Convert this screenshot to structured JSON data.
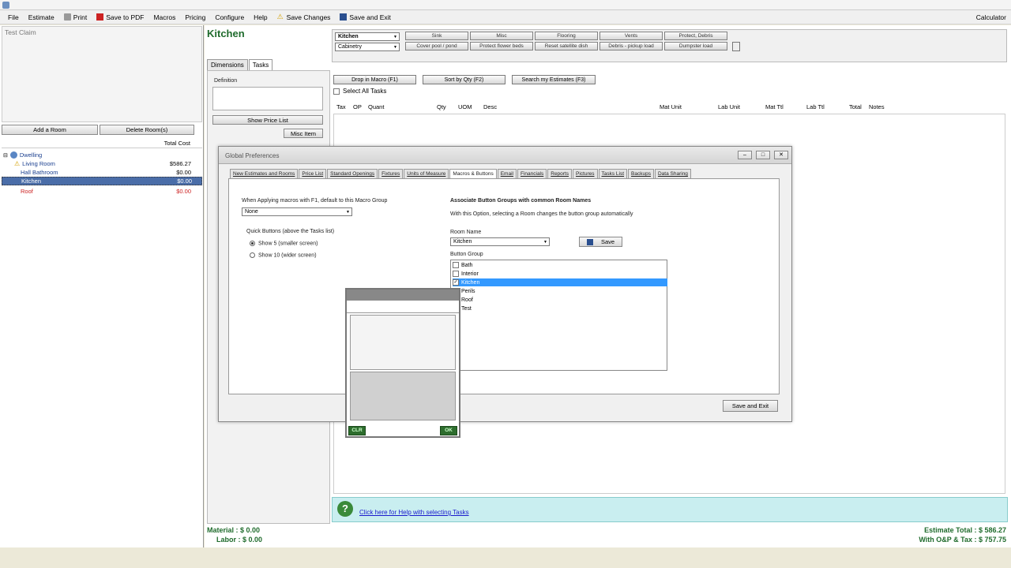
{
  "menu": {
    "file": "File",
    "estimate": "Estimate",
    "print": "Print",
    "save_pdf": "Save to PDF",
    "macros": "Macros",
    "pricing": "Pricing",
    "configure": "Configure",
    "help": "Help",
    "save_changes": "Save Changes",
    "save_exit": "Save and Exit",
    "calculator": "Calculator"
  },
  "left": {
    "claim": "Test Claim",
    "add_room": "Add a Room",
    "delete_room": "Delete Room(s)",
    "total_cost_header": "Total Cost",
    "tree": [
      {
        "label": "Dwelling",
        "cost": ""
      },
      {
        "label": "Living Room",
        "cost": "$586.27"
      },
      {
        "label": "Hall Bathroom",
        "cost": "$0.00"
      },
      {
        "label": "Kitchen",
        "cost": "$0.00"
      },
      {
        "label": "Roof",
        "cost": "$0.00"
      }
    ]
  },
  "main": {
    "room_title": "Kitchen",
    "group1": "Kitchen",
    "group2": "Cabinetry",
    "buttons_row1": [
      "Sink",
      "Misc",
      "Flooring",
      "Vents",
      "Protect, Debris"
    ],
    "buttons_row2": [
      "Cover pool / pond",
      "Protect flower beds",
      "Reset satellite dish",
      "Debris - pickup load",
      "Dumpster load"
    ],
    "tab_dimensions": "Dimensions",
    "tab_tasks": "Tasks",
    "definition_label": "Definition",
    "show_price_list": "Show Price List",
    "misc_item": "Misc Item",
    "drop_macro": "Drop in Macro (F1)",
    "sort_qty": "Sort by Qty (F2)",
    "search_estimates": "Search my Estimates (F3)",
    "select_all": "Select All Tasks",
    "columns": [
      "Tax",
      "OP",
      "Quant",
      "Qty",
      "UOM",
      "Desc",
      "Mat Unit",
      "Lab Unit",
      "Mat Ttl",
      "Lab Ttl",
      "Total",
      "Notes"
    ],
    "help_link": "Click here for Help with selecting Tasks",
    "help_icon": "?",
    "material": "Material : $ 0.00",
    "labor": "Labor : $ 0.00",
    "estimate_total": "Estimate Total : $ 586.27",
    "with_op_tax": "With O&P & Tax : $ 757.75"
  },
  "dialog": {
    "title": "Global Preferences",
    "tabs": [
      "New Estimates and Rooms",
      "Price List",
      "Standard Openings",
      "Fixtures",
      "Units of Measure",
      "Macros & Buttons",
      "Email",
      "Financials",
      "Reports",
      "Pictures",
      "Tasks List",
      "Backups",
      "Data Sharing"
    ],
    "active_tab": "Macros & Buttons",
    "macro_group_label": "When Applying macros with F1, default to this Macro Group",
    "macro_group_value": "None",
    "quick_buttons_label": "Quick Buttons (above the Tasks list)",
    "show5": "Show 5 (smaller screen)",
    "show10": "Show 10 (wider screen)",
    "assoc_title": "Associate Button Groups with common Room Names",
    "assoc_desc": "With this Option, selecting a Room changes the button group automatically",
    "room_name_label": "Room Name",
    "room_name_value": "Kitchen",
    "save_btn": "Save",
    "button_group_label": "Button Group",
    "groups": [
      "Bath",
      "Interior",
      "Kitchen",
      "Perils",
      "Roof",
      "Test"
    ],
    "selected_group": "Kitchen",
    "save_exit": "Save and Exit",
    "keypad_clr": "CLR",
    "keypad_ok": "OK"
  }
}
